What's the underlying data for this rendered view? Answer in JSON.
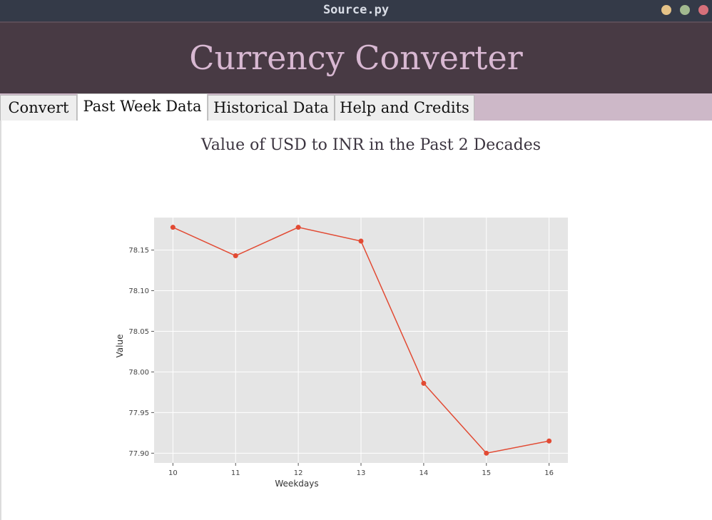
{
  "window": {
    "title": "Source.py"
  },
  "header": {
    "app_title": "Currency Converter"
  },
  "tabs": [
    {
      "label": "Convert",
      "active": false
    },
    {
      "label": "Past Week Data",
      "active": true
    },
    {
      "label": "Historical Data",
      "active": false
    },
    {
      "label": "Help and Credits",
      "active": false
    }
  ],
  "colors": {
    "accent": "#483a44",
    "title_text": "#d8b8d2",
    "tab_strip": "#cdb8c8",
    "line": "#e24a33",
    "plot_bg": "#e5e5e5"
  },
  "chart_data": {
    "type": "line",
    "title": "Value of USD to INR in the Past 2 Decades",
    "xlabel": "Weekdays",
    "ylabel": "Value",
    "x": [
      10,
      11,
      12,
      13,
      14,
      15,
      16
    ],
    "y": [
      78.178,
      78.143,
      78.178,
      78.161,
      77.986,
      77.9,
      77.915
    ],
    "xticks": [
      "10",
      "11",
      "12",
      "13",
      "14",
      "15",
      "16"
    ],
    "yticks": [
      "77.90",
      "77.95",
      "78.00",
      "78.05",
      "78.10",
      "78.15"
    ],
    "xlim": [
      9.7,
      16.3
    ],
    "ylim": [
      77.888,
      78.19
    ],
    "grid": true,
    "marker": "circle"
  }
}
